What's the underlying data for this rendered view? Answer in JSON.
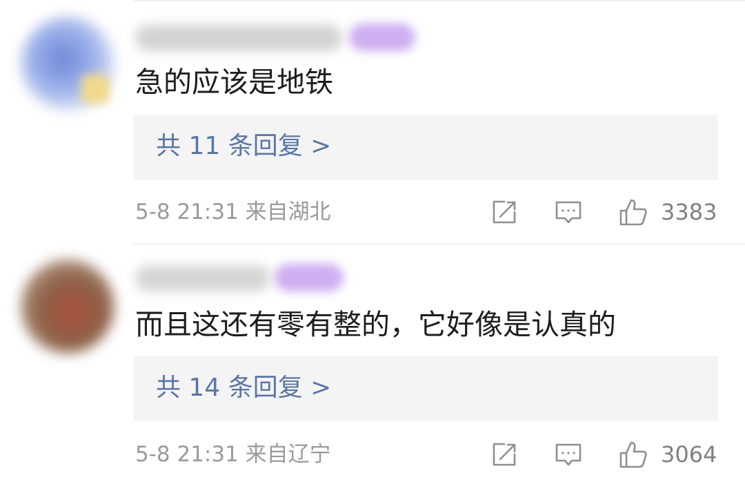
{
  "comments": [
    {
      "text": "急的应该是地铁",
      "replies_label": "共 11 条回复 >",
      "meta": "5-8 21:31 来自湖北",
      "likes": "3383"
    },
    {
      "text": "而且这还有零有整的，它好像是认真的",
      "replies_label": "共 14 条回复 >",
      "meta": "5-8 21:31 来自辽宁",
      "likes": "3064"
    }
  ],
  "icons": {
    "share": "share-icon",
    "comment": "comment-icon",
    "like": "thumbs-up-icon"
  },
  "colors": {
    "link": "#5a76a6",
    "meta": "#9a9a9a",
    "reply_bg": "#f4f4f4"
  }
}
